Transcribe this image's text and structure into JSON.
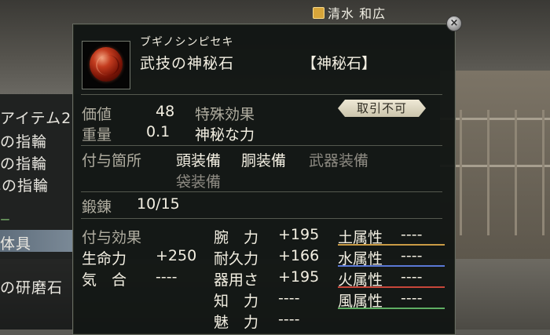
{
  "background": {
    "player_name": "清水 和広",
    "left_list": [
      "アイテム2",
      "の指輪",
      "の指輪",
      "色の指輪",
      "体具",
      "の研磨石"
    ]
  },
  "item": {
    "reading": "ブギノシンピセキ",
    "name": "武技の神秘石",
    "category": "【神秘石】",
    "icon": "red-orb-icon",
    "value_label": "価値",
    "value": "48",
    "weight_label": "重量",
    "weight": "0.1",
    "special_label": "特殊効果",
    "special_value": "神秘な力",
    "trade_badge": "取引不可",
    "attach_label": "付与箇所",
    "slots": {
      "head": "頭装備",
      "body": "胴装備",
      "weapon": "武器装備",
      "bag": "袋装備"
    },
    "forge_label": "鍛錬",
    "forge_value": "10/15",
    "effect_label": "付与効果",
    "effects_left": [
      {
        "label": "生命力",
        "value": "+250"
      },
      {
        "label": "気　合",
        "value": "----"
      }
    ],
    "effects_mid": [
      {
        "label": "腕　力",
        "value": "+195"
      },
      {
        "label": "耐久力",
        "value": "+166"
      },
      {
        "label": "器用さ",
        "value": "+195"
      },
      {
        "label": "知　力",
        "value": "----"
      },
      {
        "label": "魅　力",
        "value": "----"
      }
    ],
    "elements": [
      {
        "label": "土属性",
        "value": "----",
        "color": "#c99b45"
      },
      {
        "label": "水属性",
        "value": "----",
        "color": "#5a78d6"
      },
      {
        "label": "火属性",
        "value": "----",
        "color": "#c8463a"
      },
      {
        "label": "風属性",
        "value": "----",
        "color": "#5fae63"
      }
    ]
  }
}
